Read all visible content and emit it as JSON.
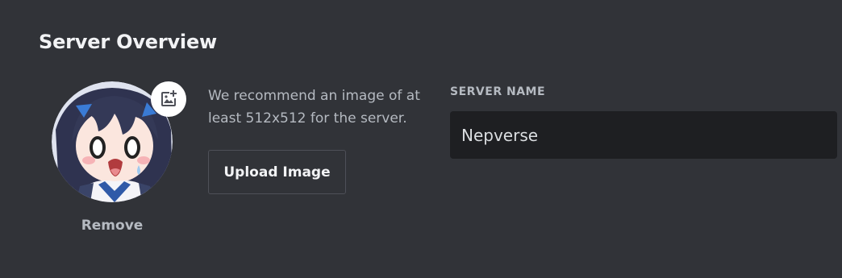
{
  "page": {
    "title": "Server Overview"
  },
  "icon": {
    "remove_label": "Remove",
    "upload_badge_icon": "image-plus-icon",
    "recommendation": "We recommend an image of at least 512x512 for the server.",
    "upload_button_label": "Upload Image"
  },
  "server_name": {
    "label": "SERVER NAME",
    "value": "Nepverse"
  },
  "colors": {
    "background": "#313338",
    "input_background": "#1e1f22",
    "text_primary": "#f2f3f5",
    "text_muted": "#b5bac1"
  }
}
